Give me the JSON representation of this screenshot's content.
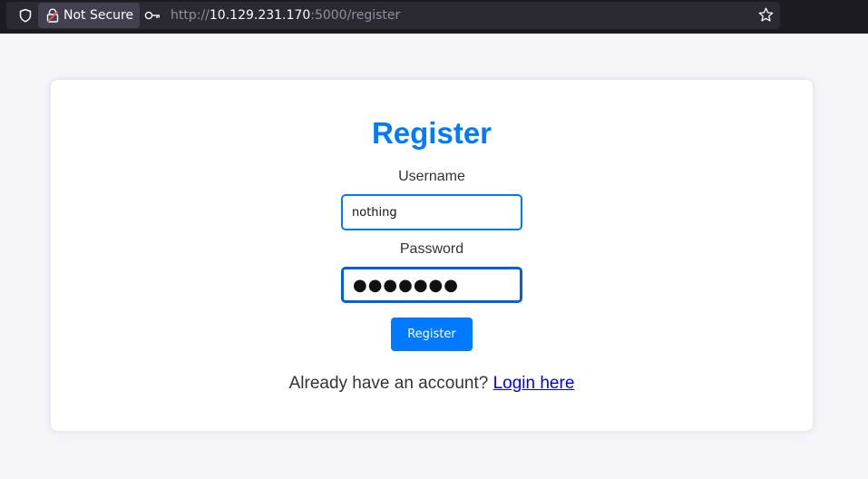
{
  "browser": {
    "security_label": "Not Secure",
    "url_scheme": "http://",
    "url_host": "10.129.231.170",
    "url_rest": ":5000/register"
  },
  "form": {
    "title": "Register",
    "username_label": "Username",
    "username_value": "nothing",
    "password_label": "Password",
    "password_value": "●●●●●●●",
    "submit_label": "Register",
    "footer_text": "Already have an account?",
    "login_link": "Login here"
  },
  "icons": {
    "shield": "shield-icon",
    "lock": "lock-icon",
    "key": "key-icon",
    "star": "star-icon"
  },
  "colors": {
    "accent": "#007bff",
    "page_bg": "#f4f4f9",
    "card_bg": "#ffffff",
    "link": "#0000ee"
  }
}
